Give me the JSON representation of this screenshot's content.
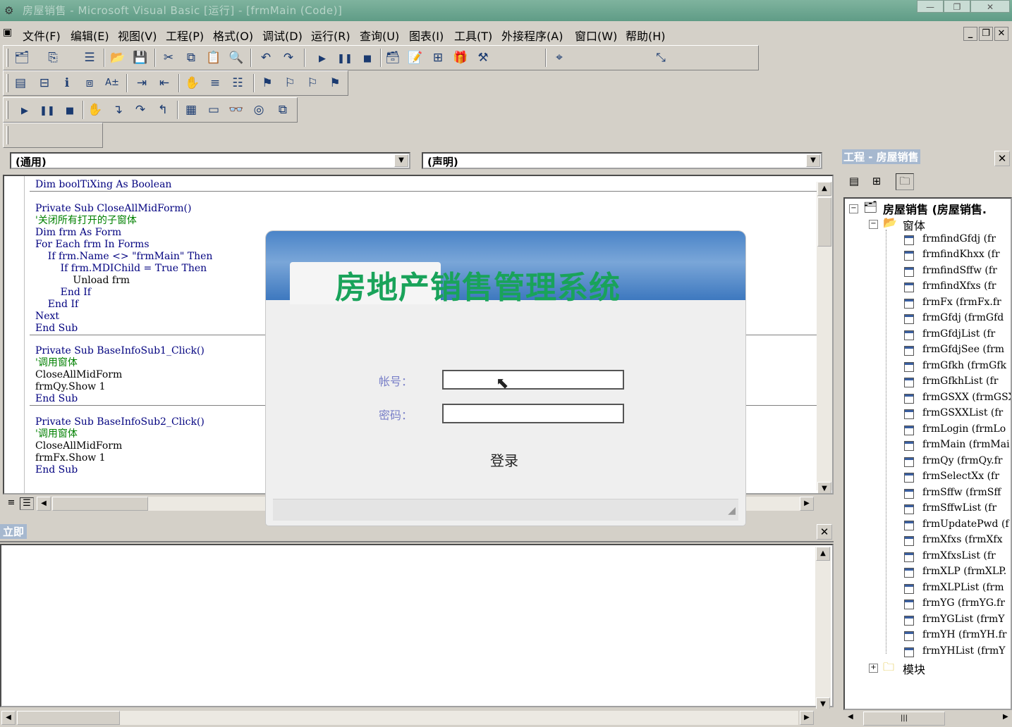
{
  "window": {
    "title": "房屋销售 - Microsoft Visual Basic [运行] - [frmMain (Code)]",
    "min_label": "—",
    "max_label": "❐",
    "close_label": "✕"
  },
  "menu": [
    {
      "label": "文件(F)"
    },
    {
      "label": "编辑(E)"
    },
    {
      "label": "视图(V)"
    },
    {
      "label": "工程(P)"
    },
    {
      "label": "格式(O)"
    },
    {
      "label": "调试(D)"
    },
    {
      "label": "运行(R)"
    },
    {
      "label": "查询(U)"
    },
    {
      "label": "图表(I)"
    },
    {
      "label": "工具(T)"
    },
    {
      "label": "外接程序(A)"
    },
    {
      "label": "窗口(W)"
    },
    {
      "label": "帮助(H)"
    }
  ],
  "code_window": {
    "object_combo": "(通用)",
    "procedure_combo": "(声明)",
    "lines": [
      {
        "text": "Dim boolTiXing As Boolean",
        "kind": "kw"
      },
      {
        "text": "Private Sub CloseAllMidForm()",
        "kind": "kw"
      },
      {
        "text": "'关闭所有打开的子窗体",
        "kind": "comment"
      },
      {
        "text": "Dim frm As Form",
        "kind": "kw"
      },
      {
        "text": "For Each frm In Forms",
        "kind": "kw"
      },
      {
        "text": "    If frm.Name <> \"frmMain\" Then",
        "kind": "kw"
      },
      {
        "text": "        If frm.MDIChild = True Then",
        "kind": "kw"
      },
      {
        "text": "            Unload frm",
        "kind": "plain"
      },
      {
        "text": "        End If",
        "kind": "kw"
      },
      {
        "text": "    End If",
        "kind": "kw"
      },
      {
        "text": "Next",
        "kind": "kw"
      },
      {
        "text": "End Sub",
        "kind": "kw"
      },
      {
        "text": "Private Sub BaseInfoSub1_Click()",
        "kind": "kw"
      },
      {
        "text": "'调用窗体",
        "kind": "comment"
      },
      {
        "text": "CloseAllMidForm",
        "kind": "plain"
      },
      {
        "text": "frmQy.Show 1",
        "kind": "plain"
      },
      {
        "text": "End Sub",
        "kind": "kw"
      },
      {
        "text": "Private Sub BaseInfoSub2_Click()",
        "kind": "kw"
      },
      {
        "text": "'调用窗体",
        "kind": "comment"
      },
      {
        "text": "CloseAllMidForm",
        "kind": "plain"
      },
      {
        "text": "frmFx.Show 1",
        "kind": "plain"
      },
      {
        "text": "End Sub",
        "kind": "kw"
      }
    ]
  },
  "immediate": {
    "title": "立即",
    "close_label": "✕"
  },
  "project": {
    "title": "工程 - 房屋销售",
    "close_label": "✕",
    "root": "房屋销售 (房屋销售.",
    "forms_folder": "窗体",
    "modules_folder": "模块",
    "forms": [
      "frmfindGfdj (fr",
      "frmfindKhxx (fr",
      "frmfindSffw (fr",
      "frmfindXfxs (fr",
      "frmFx (frmFx.fr",
      "frmGfdj (frmGfd",
      "frmGfdjList (fr",
      "frmGfdjSee (frm",
      "frmGfkh (frmGfk",
      "frmGfkhList (fr",
      "frmGSXX (frmGSX",
      "frmGSXXList (fr",
      "frmLogin (frmLo",
      "frmMain (frmMai",
      "frmQy (frmQy.fr",
      "frmSelectXx (fr",
      "frmSffw (frmSff",
      "frmSffwList (fr",
      "frmUpdatePwd (f",
      "frmXfxs (frmXfx",
      "frmXfxsList (fr",
      "frmXLP (frmXLP.",
      "frmXLPList (frm",
      "frmYG (frmYG.fr",
      "frmYGList (frmY",
      "frmYH (frmYH.fr",
      "frmYHList (frmY"
    ]
  },
  "login": {
    "system_title": "房地产销售管理系统",
    "account_label": "帐号：",
    "password_label": "密码：",
    "account_value": "",
    "password_value": "",
    "login_button": "登录"
  },
  "colors": {
    "keyword": "#00007f",
    "comment": "#008000",
    "login_title": "#19a35a",
    "login_label": "#7a80c8"
  },
  "icons": {
    "toolbar1": [
      "add-project-icon",
      "add-form-icon",
      "menu-editor-icon",
      "open-icon",
      "save-icon",
      "cut-icon",
      "copy-icon",
      "paste-icon",
      "find-icon",
      "undo-icon",
      "redo-icon",
      "run-icon",
      "pause-icon",
      "stop-icon",
      "project-explorer-icon",
      "properties-icon",
      "form-layout-icon",
      "object-browser-icon",
      "toolbox-icon"
    ],
    "toolbar2": [
      "list-properties-icon",
      "list-constants-icon",
      "quick-info-icon",
      "parameter-info-icon",
      "complete-word-icon",
      "indent-icon",
      "outdent-icon",
      "toggle-breakpoint-icon",
      "comment-block-icon",
      "uncomment-block-icon",
      "toggle-bookmark-icon",
      "next-bookmark-icon",
      "previous-bookmark-icon",
      "clear-bookmarks-icon"
    ],
    "toolbar3": [
      "continue-icon",
      "break-icon",
      "end-icon",
      "breakpoint-icon",
      "step-into-icon",
      "step-over-icon",
      "step-out-icon",
      "locals-icon",
      "immediate-icon",
      "watch-icon",
      "quick-watch-icon",
      "call-stack-icon"
    ]
  }
}
